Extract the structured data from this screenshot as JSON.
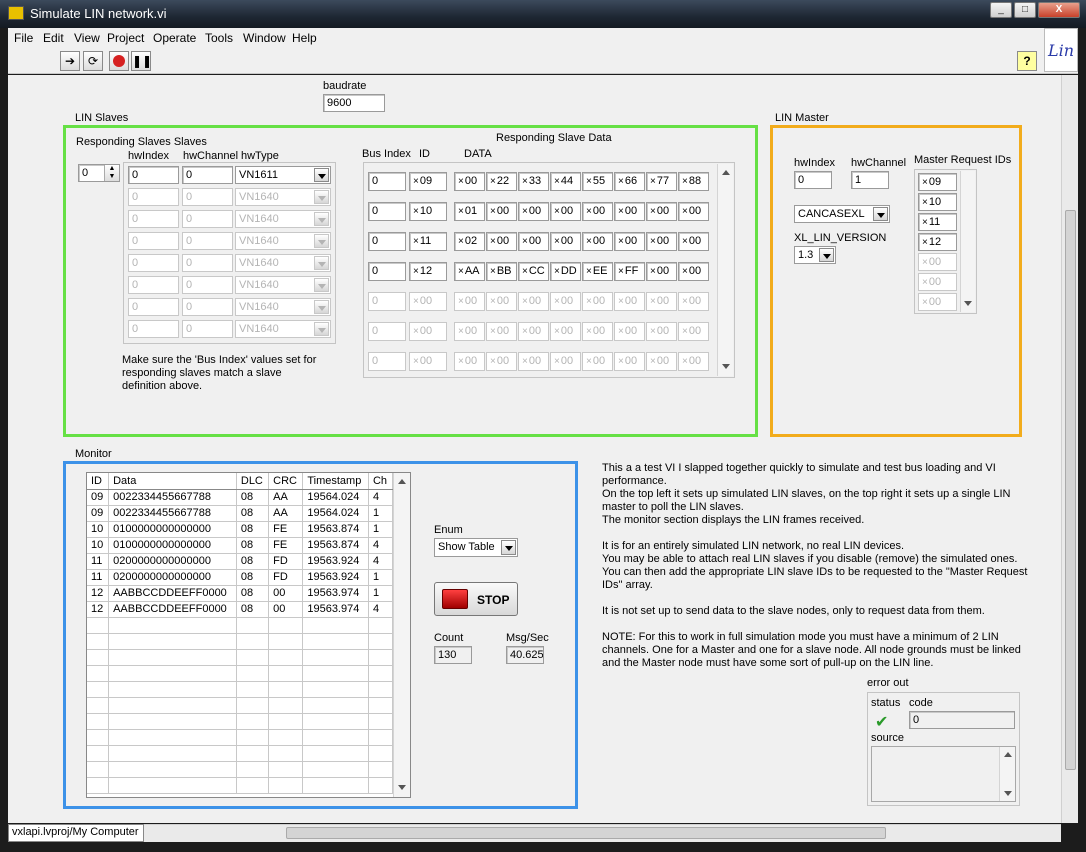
{
  "window": {
    "title": "Simulate LIN network.vi",
    "min_label": "_",
    "max_label": "□",
    "close_label": "X"
  },
  "menu": [
    "File",
    "Edit",
    "View",
    "Project",
    "Operate",
    "Tools",
    "Window",
    "Help"
  ],
  "toolbar": {
    "help_label": "?",
    "logo_text": "Lin"
  },
  "baudrate": {
    "label": "baudrate",
    "value": "9600"
  },
  "lin_slaves": {
    "section_label": "LIN Slaves",
    "responding_label": "Responding Slaves Slaves",
    "index_value": "0",
    "col_hwindex": "hwIndex",
    "col_hwchannel": "hwChannel",
    "col_hwtype": "hwType",
    "rows": [
      {
        "hwIndex": "0",
        "hwChannel": "0",
        "hwType": "VN1611",
        "active": true
      },
      {
        "hwIndex": "0",
        "hwChannel": "0",
        "hwType": "VN1640",
        "active": false
      },
      {
        "hwIndex": "0",
        "hwChannel": "0",
        "hwType": "VN1640",
        "active": false
      },
      {
        "hwIndex": "0",
        "hwChannel": "0",
        "hwType": "VN1640",
        "active": false
      },
      {
        "hwIndex": "0",
        "hwChannel": "0",
        "hwType": "VN1640",
        "active": false
      },
      {
        "hwIndex": "0",
        "hwChannel": "0",
        "hwType": "VN1640",
        "active": false
      },
      {
        "hwIndex": "0",
        "hwChannel": "0",
        "hwType": "VN1640",
        "active": false
      },
      {
        "hwIndex": "0",
        "hwChannel": "0",
        "hwType": "VN1640",
        "active": false
      }
    ],
    "note": "Make sure the 'Bus Index' values set for responding slaves match a slave definition above.",
    "data_label": "Responding Slave Data",
    "col_bus_index": "Bus Index",
    "col_id": "ID",
    "col_data": "DATA",
    "data_rows": [
      {
        "bus": "0",
        "id": "09",
        "data": [
          "00",
          "22",
          "33",
          "44",
          "55",
          "66",
          "77",
          "88"
        ],
        "active": true
      },
      {
        "bus": "0",
        "id": "10",
        "data": [
          "01",
          "00",
          "00",
          "00",
          "00",
          "00",
          "00",
          "00"
        ],
        "active": true
      },
      {
        "bus": "0",
        "id": "11",
        "data": [
          "02",
          "00",
          "00",
          "00",
          "00",
          "00",
          "00",
          "00"
        ],
        "active": true
      },
      {
        "bus": "0",
        "id": "12",
        "data": [
          "AA",
          "BB",
          "CC",
          "DD",
          "EE",
          "FF",
          "00",
          "00"
        ],
        "active": true
      },
      {
        "bus": "0",
        "id": "00",
        "data": [
          "00",
          "00",
          "00",
          "00",
          "00",
          "00",
          "00",
          "00"
        ],
        "active": false
      },
      {
        "bus": "0",
        "id": "00",
        "data": [
          "00",
          "00",
          "00",
          "00",
          "00",
          "00",
          "00",
          "00"
        ],
        "active": false
      },
      {
        "bus": "0",
        "id": "00",
        "data": [
          "00",
          "00",
          "00",
          "00",
          "00",
          "00",
          "00",
          "00"
        ],
        "active": false
      }
    ]
  },
  "lin_master": {
    "section_label": "LIN Master",
    "hwindex_label": "hwIndex",
    "hwindex_value": "0",
    "hwchannel_label": "hwChannel",
    "hwchannel_value": "1",
    "cancase_value": "CANCASEXL",
    "version_label": "XL_LIN_VERSION",
    "version_value": "1.3",
    "request_label": "Master Request IDs",
    "request_ids": [
      {
        "v": "09",
        "active": true
      },
      {
        "v": "10",
        "active": true
      },
      {
        "v": "11",
        "active": true
      },
      {
        "v": "12",
        "active": true
      },
      {
        "v": "00",
        "active": false
      },
      {
        "v": "00",
        "active": false
      },
      {
        "v": "00",
        "active": false
      }
    ]
  },
  "monitor": {
    "section_label": "Monitor",
    "columns": [
      "ID",
      "Data",
      "DLC",
      "CRC",
      "Timestamp",
      "Ch"
    ],
    "rows": [
      [
        "09",
        "0022334455667788",
        "08",
        "AA",
        "19564.024",
        "4"
      ],
      [
        "09",
        "0022334455667788",
        "08",
        "AA",
        "19564.024",
        "1"
      ],
      [
        "10",
        "0100000000000000",
        "08",
        "FE",
        "19563.874",
        "1"
      ],
      [
        "10",
        "0100000000000000",
        "08",
        "FE",
        "19563.874",
        "4"
      ],
      [
        "11",
        "0200000000000000",
        "08",
        "FD",
        "19563.924",
        "4"
      ],
      [
        "11",
        "0200000000000000",
        "08",
        "FD",
        "19563.924",
        "1"
      ],
      [
        "12",
        "AABBCCDDEEFF0000",
        "08",
        "00",
        "19563.974",
        "1"
      ],
      [
        "12",
        "AABBCCDDEEFF0000",
        "08",
        "00",
        "19563.974",
        "4"
      ]
    ],
    "enum_label": "Enum",
    "enum_value": "Show Table",
    "stop_label": "STOP",
    "count_label": "Count",
    "count_value": "130",
    "msgsec_label": "Msg/Sec",
    "msgsec_value": "40.625"
  },
  "description": [
    "This a a test VI I slapped together quickly to simulate and test bus loading and VI performance.",
    "On the top left it sets up simulated LIN slaves, on the top right it sets up a single LIN master to poll the LIN slaves.",
    "The monitor section displays the LIN frames received.",
    "",
    "It is for an entirely simulated LIN network, no real LIN devices.",
    "You may be able to attach real LIN slaves if you disable (remove) the simulated ones.",
    "You can then add the appropriate LIN slave IDs to be requested to the \"Master Request IDs\" array.",
    "",
    "It is not set up to send data to the slave nodes, only to request data from them.",
    "",
    "NOTE: For this to work in full simulation mode you must have a minimum of 2 LIN channels. One for a Master and one for a slave node. All node grounds must be linked and the Master node must have some sort of pull-up on the LIN line."
  ],
  "error_out": {
    "label": "error out",
    "status_label": "status",
    "code_label": "code",
    "code_value": "0",
    "source_label": "source",
    "status_mark": "✔"
  },
  "statusbar": {
    "project": "vxlapi.lvproj/My Computer"
  },
  "colors": {
    "slaves_border": "#66e045",
    "master_border": "#f2ac1c",
    "monitor_border": "#3d92e8",
    "stop_red": "#d62020"
  }
}
